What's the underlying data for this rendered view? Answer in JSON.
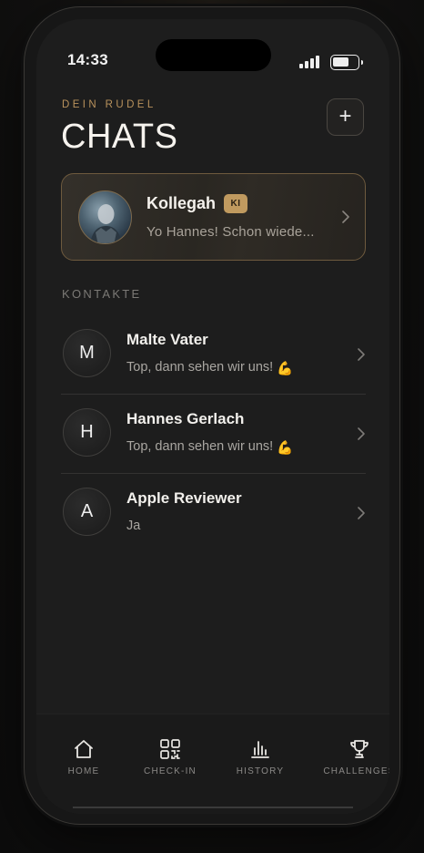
{
  "status_bar": {
    "time": "14:33"
  },
  "header": {
    "eyebrow": "DEIN RUDEL",
    "title": "CHATS"
  },
  "featured_chat": {
    "name": "Kollegah",
    "badge": "KI",
    "preview": "Yo Hannes! Schon wiede..."
  },
  "contacts_section": {
    "label": "KONTAKTE"
  },
  "contacts": [
    {
      "initial": "M",
      "name": "Malte Vater",
      "preview": "Top, dann sehen wir uns!",
      "emoji": "💪"
    },
    {
      "initial": "H",
      "name": "Hannes Gerlach",
      "preview": "Top, dann sehen wir uns!",
      "emoji": "💪"
    },
    {
      "initial": "A",
      "name": "Apple Reviewer",
      "preview": "Ja",
      "emoji": ""
    }
  ],
  "tab_bar": {
    "items": [
      {
        "label": "HOME",
        "icon": "home-icon"
      },
      {
        "label": "CHECK-IN",
        "icon": "qr-code-icon"
      },
      {
        "label": "HISTORY",
        "icon": "bar-chart-icon"
      },
      {
        "label": "CHALLENGES",
        "icon": "trophy-icon"
      }
    ]
  },
  "colors": {
    "accent_gold": "#b9925c",
    "badge_gold": "#c09a5f",
    "background": "#1d1d1d",
    "text_primary": "#f4f1ec",
    "text_secondary": "#a9a6a1"
  }
}
